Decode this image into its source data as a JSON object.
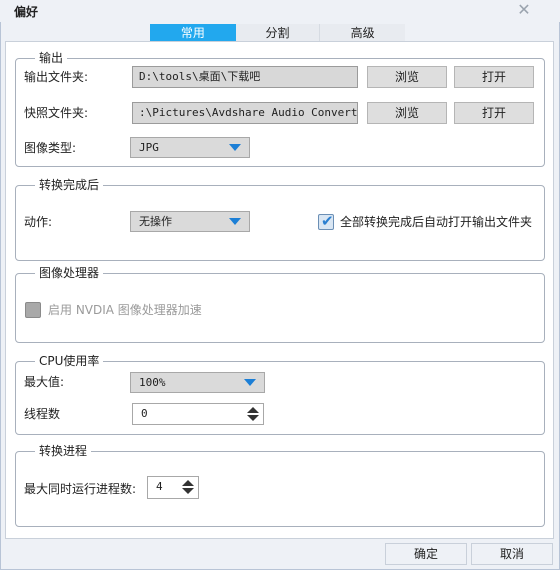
{
  "window": {
    "title": "偏好",
    "close_glyph": "✕"
  },
  "tabs": [
    {
      "label": "常用"
    },
    {
      "label": "分割"
    },
    {
      "label": "高级"
    }
  ],
  "output": {
    "legend": "输出",
    "output_folder_label": "输出文件夹:",
    "output_folder_value": "D:\\tools\\桌面\\下载吧",
    "snapshot_folder_label": "快照文件夹:",
    "snapshot_folder_value": ":\\Pictures\\Avdshare Audio Converter",
    "browse_label": "浏览",
    "open_label": "打开",
    "image_type_label": "图像类型:",
    "image_type_value": "JPG"
  },
  "after_convert": {
    "legend": "转换完成后",
    "action_label": "动作:",
    "action_value": "无操作",
    "auto_open_label": "全部转换完成后自动打开输出文件夹",
    "auto_open_checked": true
  },
  "gpu": {
    "legend": "图像处理器",
    "enable_label": "启用 NVDIA 图像处理器加速",
    "enabled": false
  },
  "cpu": {
    "legend": "CPU使用率",
    "max_label": "最大值:",
    "max_value": "100%",
    "threads_label": "线程数",
    "threads_value": "0"
  },
  "process": {
    "legend": "转换进程",
    "max_concurrent_label": "最大同时运行进程数:",
    "max_concurrent_value": "4"
  },
  "footer": {
    "ok_label": "确定",
    "cancel_label": "取消"
  },
  "colors": {
    "active_tab": "#22a8ee",
    "select_caret": "#1c7fd6"
  }
}
